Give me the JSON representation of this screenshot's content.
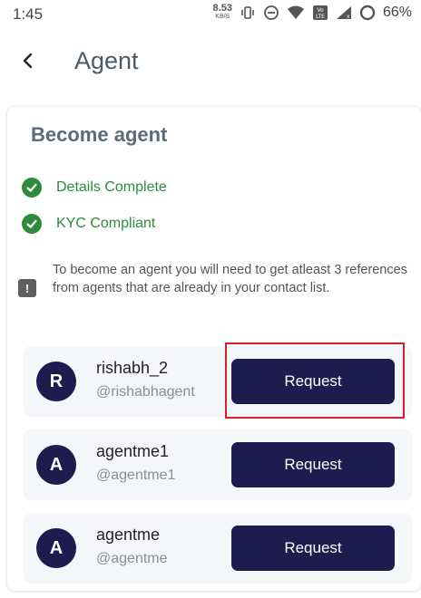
{
  "status_bar": {
    "time": "1:45",
    "net_speed_value": "8.53",
    "net_speed_unit": "KB/S",
    "battery_percent": "66%",
    "icons": [
      "vibrate-icon",
      "dnd-icon",
      "wifi-icon",
      "volte-icon",
      "signal-icon",
      "battery-icon"
    ]
  },
  "app_bar": {
    "title": "Agent",
    "back_icon": "chevron-left-icon"
  },
  "card": {
    "title": "Become agent",
    "checks": [
      {
        "label": "Details Complete",
        "icon": "check-circle-icon"
      },
      {
        "label": "KYC Compliant",
        "icon": "check-circle-icon"
      }
    ],
    "notice": {
      "icon": "exclamation-icon",
      "text": "To become an agent you will need to get atleast 3 references from agents that are already in your contact list."
    },
    "agents": [
      {
        "initial": "R",
        "name": "rishabh_2",
        "handle": "@rishabhagent",
        "button_label": "Request"
      },
      {
        "initial": "A",
        "name": "agentme1",
        "handle": "@agentme1",
        "button_label": "Request"
      },
      {
        "initial": "A",
        "name": "agentme",
        "handle": "@agentme",
        "button_label": "Request"
      }
    ]
  },
  "colors": {
    "primary": "#1e1b4f",
    "success": "#2e8b3e",
    "highlight": "#d81f26",
    "title": "#4a5a6a"
  }
}
